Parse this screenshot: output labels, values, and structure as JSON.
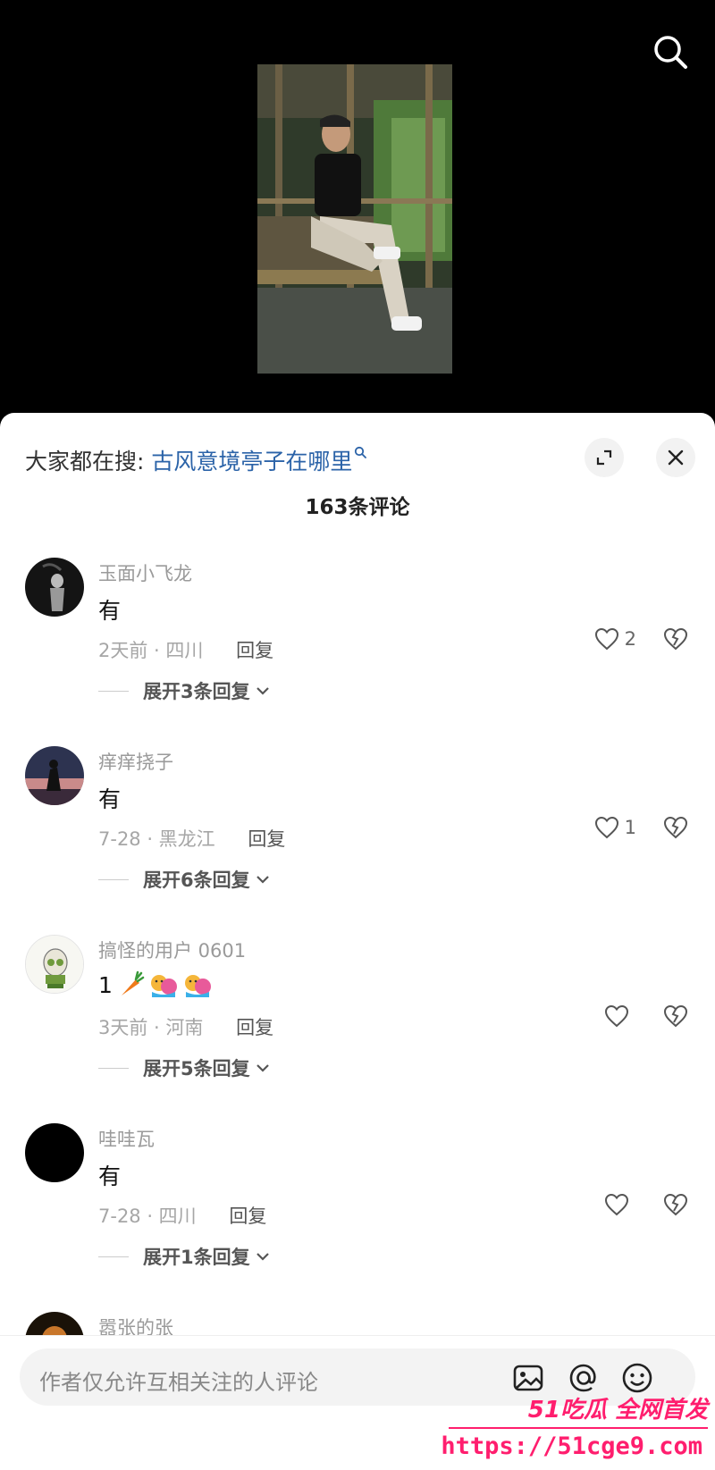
{
  "header": {
    "hot_prefix": "大家都在搜:",
    "hot_query": "古风意境亭子在哪里",
    "comment_count": "163条评论"
  },
  "comments": [
    {
      "username": "玉面小飞龙",
      "text": "有",
      "time": "2天前 · 四川",
      "reply": "回复",
      "likes": "2",
      "expand": "展开3条回复"
    },
    {
      "username": "痒痒挠子",
      "text": "有",
      "time": "7-28 · 黑龙江",
      "reply": "回复",
      "likes": "1",
      "expand": "展开6条回复"
    },
    {
      "username": "搞怪的用户 0601",
      "text": "1",
      "emojis": [
        "carrot-emoji",
        "hug-emoji",
        "hug-emoji"
      ],
      "time": "3天前 · 河南",
      "reply": "回复",
      "likes": "",
      "expand": "展开5条回复"
    },
    {
      "username": "哇哇瓦",
      "text": "有",
      "time": "7-28 · 四川",
      "reply": "回复",
      "likes": "",
      "expand": "展开1条回复"
    },
    {
      "username": "嚣张的张"
    }
  ],
  "input": {
    "placeholder": "作者仅允许互相关注的人评论"
  },
  "watermark": {
    "brand": "51吃瓜 全网首发",
    "url": "https://51cge9.com"
  },
  "colors": {
    "accent_link": "#2b63a8",
    "watermark": "#ff1e6e",
    "sheet_bg": "#ffffff",
    "video_bg": "#000000"
  }
}
